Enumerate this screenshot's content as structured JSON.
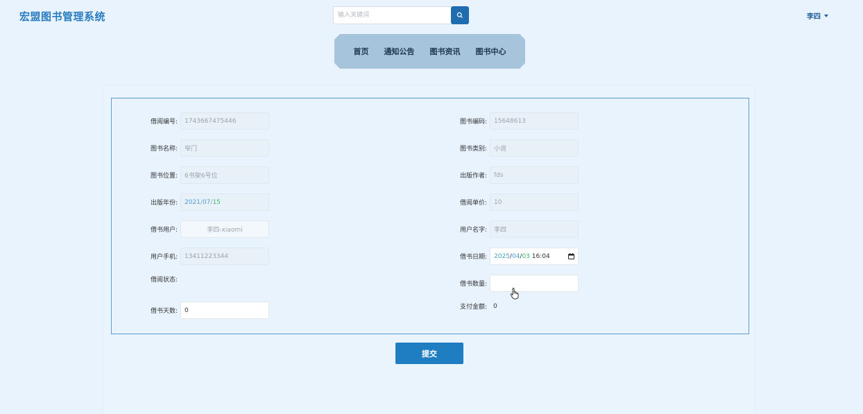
{
  "header": {
    "brand": "宏盟图书管理系统",
    "search_placeholder": "输入关键词",
    "user_name": "李四"
  },
  "nav": {
    "items": [
      {
        "label": "首页"
      },
      {
        "label": "通知公告"
      },
      {
        "label": "图书资讯"
      },
      {
        "label": "图书中心"
      }
    ]
  },
  "form": {
    "left": [
      {
        "label": "借阅编号:",
        "value": "1743667475446"
      },
      {
        "label": "图书名称:",
        "value": "窄门"
      },
      {
        "label": "图书位置:",
        "value": "6书架6号位"
      },
      {
        "label": "出版年份:",
        "value_year": "2021",
        "value_month": "07",
        "value_day": "15"
      },
      {
        "label": "借书用户:",
        "value": "李四-xiaomi"
      },
      {
        "label": "用户手机:",
        "value": "13411223344"
      },
      {
        "label": "借阅状态:",
        "value": ""
      },
      {
        "label": "借书天数:",
        "value": "0"
      }
    ],
    "right": [
      {
        "label": "图书编码:",
        "value": "15648613"
      },
      {
        "label": "图书类别:",
        "value": "小说"
      },
      {
        "label": "出版作者:",
        "value": "fds"
      },
      {
        "label": "借阅单价:",
        "value": "10"
      },
      {
        "label": "用户名字:",
        "value": "李四"
      },
      {
        "label": "借书日期:",
        "value_year": "2025",
        "value_month": "04",
        "value_day": "03",
        "value_time": "16:04"
      },
      {
        "label": "借书数量:",
        "value": ""
      },
      {
        "label": "支付金额:",
        "value": "0"
      }
    ],
    "submit_label": "提交"
  },
  "icons": {
    "search": "search-icon",
    "caret": "chevron-down-icon",
    "calendar": "calendar-icon",
    "cursor": "hand-pointer-icon"
  },
  "colors": {
    "brand": "#2a7cc0",
    "primary_button": "#1f7ec2",
    "nav_bg": "#a6c4dc",
    "page_bg": "#e8f3fd",
    "form_border": "#5a9ccc"
  }
}
